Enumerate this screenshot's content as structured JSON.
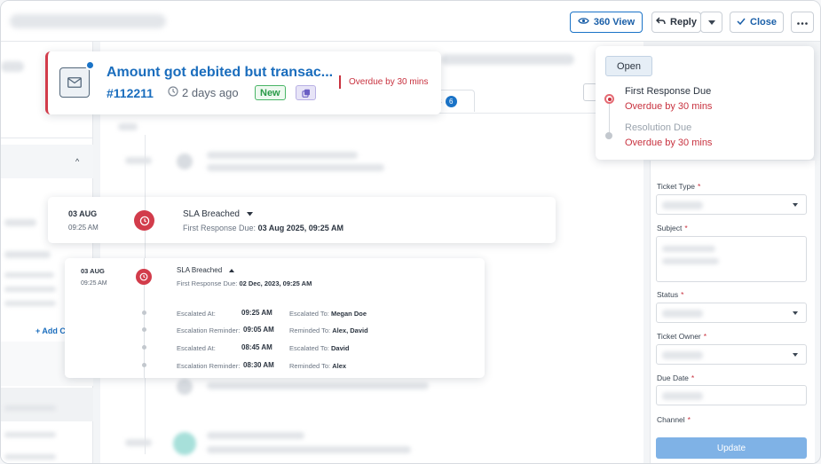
{
  "toolbar": {
    "view_360": "360 View",
    "reply": "Reply",
    "close": "Close"
  },
  "ticket": {
    "title": "Amount got debited but transac...",
    "id": "#112211",
    "age": "2 days ago",
    "status_badge": "New",
    "overdue": "Overdue by 30 mins"
  },
  "tabs": {
    "count": "6"
  },
  "sla_panel": {
    "status": "Open",
    "first_response_label": "First Response Due",
    "first_response_value": "Overdue by 30 mins",
    "resolution_label": "Resolution Due",
    "resolution_value": "Overdue by 30 mins"
  },
  "form": {
    "ticket_type": "Ticket Type",
    "subject": "Subject",
    "status": "Status",
    "ticket_owner": "Ticket Owner",
    "due_date": "Due Date",
    "channel": "Channel",
    "required_marker": "*",
    "update": "Update"
  },
  "left_panel": {
    "add_link": "+ Add C"
  },
  "sla_events": [
    {
      "date": "03 AUG",
      "time": "09:25 AM",
      "title": "SLA Breached",
      "due_label": "First Response Due:",
      "due_value": "03 Aug 2025, 09:25 AM"
    },
    {
      "date": "03 AUG",
      "time": "09:25 AM",
      "title": "SLA Breached",
      "due_label": "First Response Due:",
      "due_value": "02 Dec, 2023, 09:25 AM",
      "escalations": [
        {
          "type": "Escalated At:",
          "time": "09:25 AM",
          "to_label": "Escalated To:",
          "to": "Megan Doe"
        },
        {
          "type": "Escalation Reminder:",
          "time": "09:05 AM",
          "to_label": "Reminded To:",
          "to": "Alex, David"
        },
        {
          "type": "Escalated At:",
          "time": "08:45 AM",
          "to_label": "Escalated To:",
          "to": "David"
        },
        {
          "type": "Escalation Reminder:",
          "time": "08:30 AM",
          "to_label": "Reminded To:",
          "to": "Alex"
        }
      ]
    }
  ],
  "colors": {
    "accent": "#1a73c7",
    "danger": "#d23c4b",
    "success": "#2a9a48"
  }
}
